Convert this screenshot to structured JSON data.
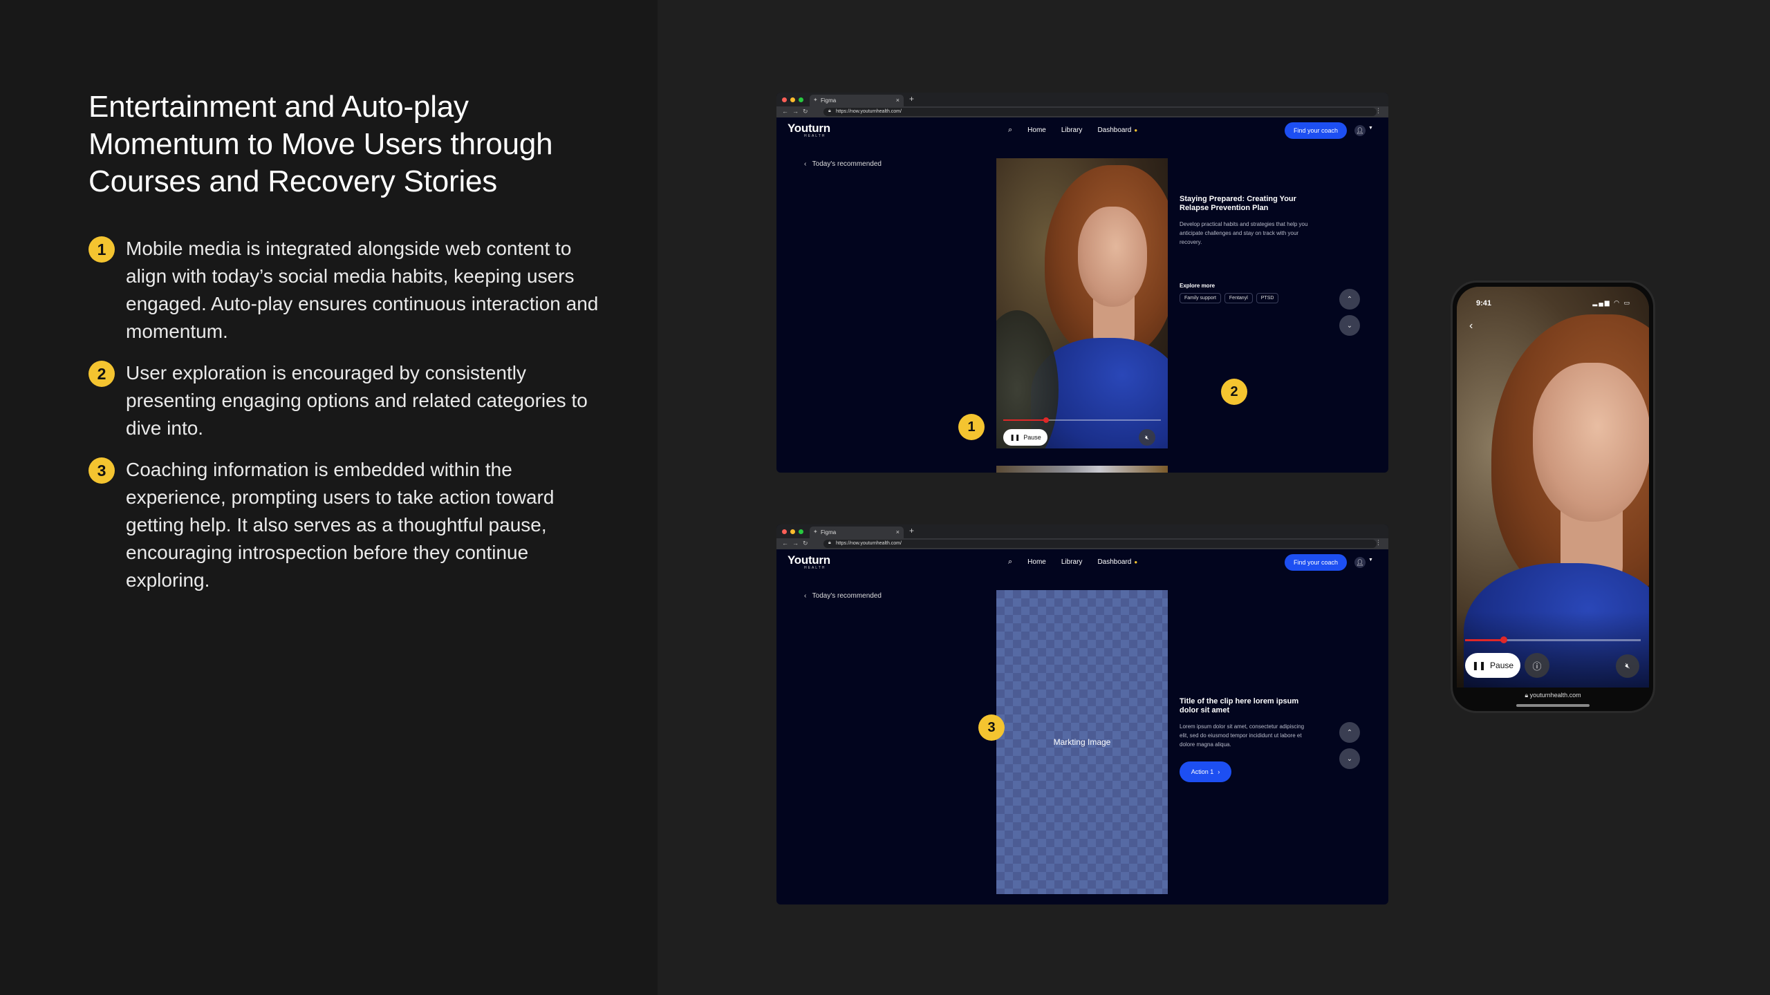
{
  "headline": "Entertainment and Auto-play Momentum to Move Users through Courses and Recovery Stories",
  "points": [
    {
      "num": "1",
      "text": "Mobile media is integrated alongside web content to align with today’s social media habits, keeping users engaged. Auto-play ensures continuous interaction and momentum."
    },
    {
      "num": "2",
      "text": "User exploration is encouraged by consistently presenting engaging options and related categories to dive into."
    },
    {
      "num": "3",
      "text": "Coaching information is embedded within the experience, prompting users to take action toward getting help. It also serves as a thoughtful pause, encouraging introspection before they continue exploring."
    }
  ],
  "browser": {
    "tab_title": "Figma",
    "url": "https://now.youturnhealth.com/",
    "window_dot_colors": [
      "#ff5f57",
      "#febc2e",
      "#28c840"
    ]
  },
  "site": {
    "logo": "Youturn",
    "logo_sub": "HEALTH",
    "nav": [
      "Home",
      "Library",
      "Dashboard"
    ],
    "coach_button": "Find your coach",
    "back_link": "Today's recommended",
    "accent_blue": "#1d4ff2",
    "callout_yellow": "#f4c430"
  },
  "screen1": {
    "title": "Staying Prepared: Creating Your Relapse Prevention Plan",
    "description": "Develop practical habits and strategies that help you anticipate challenges and stay on track with your recovery.",
    "explore_label": "Explore more",
    "chips": [
      "Family support",
      "Fentanyl",
      "PTSD"
    ],
    "pause_label": "Pause",
    "progress": 0.27
  },
  "screen2": {
    "placeholder": "Markting Image",
    "title": "Title of the clip here lorem ipsum dolor sit amet",
    "description": "Lorem ipsum dolor sit amet, consectetur adipiscing elit, sed do eiusmod tempor incididunt ut labore et dolore magna aliqua.",
    "action_label": "Action 1"
  },
  "callouts": [
    "1",
    "2",
    "3"
  ],
  "phone": {
    "time": "9:41",
    "pause_label": "Pause",
    "url": "youturnhealth.com",
    "progress": 0.22
  }
}
